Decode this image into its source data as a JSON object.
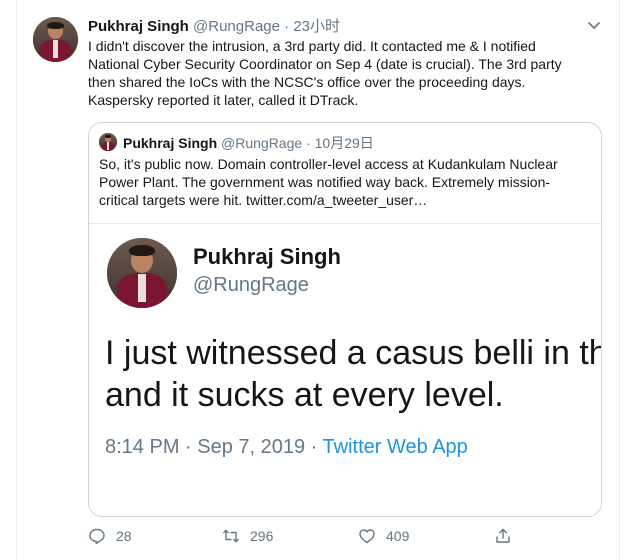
{
  "tweet": {
    "name": "Pukhraj Singh",
    "handle": "@RungRage",
    "separator": "·",
    "time": "23小时",
    "text": "I didn't discover the intrusion, a 3rd party did. It contacted me & I notified National Cyber Security Coordinator on Sep 4 (date is crucial). The 3rd party then shared the IoCs with the NCSC's office over the proceeding days. Kaspersky reported it later, called it DTrack.",
    "icons": {
      "menu": "chevron-down-icon",
      "avatar": "profile-avatar"
    }
  },
  "quote": {
    "name": "Pukhraj Singh",
    "handle": "@RungRage",
    "separator": "·",
    "date": "10月29日",
    "text": "So, it's public now. Domain controller-level access at Kudankulam Nuclear Power Plant. The government was notified way back. Extremely mission-critical targets were hit.  twitter.com/a_tweeter_user…",
    "media": {
      "name": "Pukhraj Singh",
      "handle": "@RungRage",
      "line1": "I just witnessed a casus belli in th",
      "line2": "and it sucks at every level.",
      "time": "8:14 PM · Sep 7, 2019 · ",
      "app": "Twitter Web App"
    }
  },
  "actions": {
    "reply_count": "28",
    "retweet_count": "296",
    "like_count": "409",
    "icons": [
      "reply-icon",
      "retweet-icon",
      "like-icon",
      "share-icon"
    ]
  },
  "colors": {
    "text": "#14171a",
    "muted": "#657786",
    "link": "#1b95e0",
    "border": "#ccd6dd"
  }
}
